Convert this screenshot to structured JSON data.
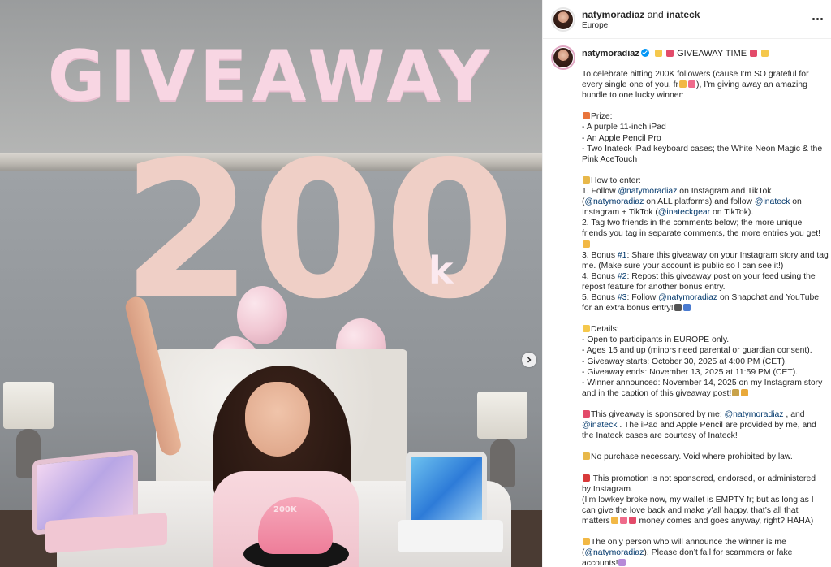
{
  "header": {
    "user1": "natymoradiaz",
    "joiner": "and",
    "user2": "inateck",
    "location": "Europe"
  },
  "media": {
    "overlay_title": "GIVEAWAY",
    "balloon_digits": "200",
    "balloon_suffix": "k",
    "cake_text": "200K"
  },
  "caption": {
    "username": "natymoradiaz",
    "title": "GIVEAWAY TIME",
    "l1": "To celebrate hitting 200K followers (cause I’m SO grateful for",
    "l2a": "every single one of you, fr",
    "l2b": "), I’m giving away an amazing",
    "l3": "bundle to one lucky winner:",
    "prize_head": "Prize:",
    "p1": "- A purple 11-inch iPad",
    "p2": "- An Apple Pencil Pro",
    "p3": "- Two Inateck iPad keyboard cases; the White Neon Magic & the",
    "p4": "Pink AceTouch",
    "enter_head": "How to enter:",
    "e1a": "1. Follow ",
    "e1m": "@natymoradiaz",
    "e1b": " on Instagram and TikTok",
    "e2a": "(",
    "e2m": "@natymoradiaz",
    "e2b": " on ALL platforms) and follow ",
    "e2m2": "@inateck",
    "e2c": " on",
    "e3a": "Instagram + TikTok (",
    "e3m": "@inateckgear",
    "e3b": " on TikTok).",
    "e4": "2. Tag two friends in the comments below; the more unique",
    "e5": "friends you tag in separate comments, the more entries you get!",
    "e7a": "3. Bonus ",
    "e7h": "#1",
    "e7b": ": Share this giveaway on your Instagram story and tag",
    "e8": "me. (Make sure your account is public so I can see it!)",
    "e9a": "4. Bonus ",
    "e9h": "#2",
    "e9b": ": Repost this giveaway post on your feed using the",
    "e10": "repost feature for another bonus entry.",
    "e11a": "5. Bonus ",
    "e11h": "#3",
    "e11b": ": Follow ",
    "e11m": "@natymoradiaz",
    "e11c": " on Snapchat and YouTube",
    "e12": "for an extra bonus entry!",
    "details_head": "Details:",
    "d1": "- Open to participants in EUROPE only.",
    "d2": "- Ages 15 and up (minors need parental or guardian consent).",
    "d3": "- Giveaway starts: October 30, 2025 at 4:00 PM (CET).",
    "d4": "- Giveaway ends: November 13, 2025 at 11:59 PM (CET).",
    "d5": "- Winner announced: November 14, 2025 on my Instagram story",
    "d6": "and in the caption of this giveaway post!",
    "s1a": "This giveaway is sponsored by me; ",
    "s1m": "@natymoradiaz",
    "s1b": " , and",
    "s2m": "@inateck",
    "s2b": " . The iPad and Apple Pencil are provided by me, and",
    "s3": "the Inateck cases are courtesy of Inateck!",
    "n1": "No purchase necessary. Void where prohibited by law.",
    "ig1": " This promotion is not sponsored, endorsed, or administered",
    "ig2": "by Instagram.",
    "ig3": "(I’m lowkey broke now, my wallet is EMPTY fr; but as long as I",
    "ig4": "can give the love back and make y’all happy, that’s all that",
    "ig5a": "matters",
    "ig5b": " money comes and goes anyway, right? HAHA)",
    "w1": "The only person who will announce the winner is me",
    "w2a": "(",
    "w2m": "@natymoradiaz",
    "w2b": "). Please don’t fall for scammers or fake",
    "w3": "accounts!"
  },
  "colors": {
    "link": "#00376b",
    "verified": "#0095f6",
    "title_overlay": "#f8d6e3",
    "balloon": "#d9a79a"
  },
  "icons": [
    "more-icon",
    "verified-icon",
    "chevron-right-icon"
  ]
}
